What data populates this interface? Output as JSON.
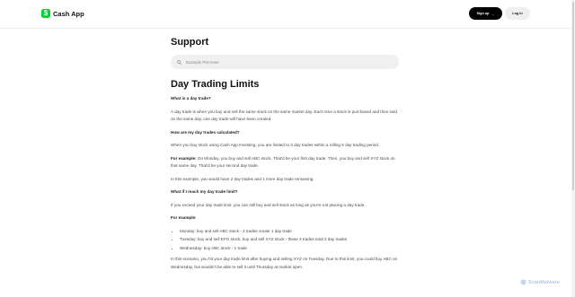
{
  "header": {
    "brand": "Cash App",
    "logo_glyph": "$",
    "signup_label": "Sign up",
    "signup_arrow": "→",
    "login_label": "Log in"
  },
  "support": {
    "title": "Support",
    "search_placeholder": "Example PIN reset"
  },
  "article": {
    "title": "Day Trading Limits",
    "q1": "What is a day trade?",
    "p1": "A day trade is when you buy and sell the same stock on the same market day. Each time a stock is purchased and then sold on the same day, one day trade will have been created.",
    "q2": "How are my day trades calculated?",
    "p2": "When you buy stock using Cash App Investing, you are limited to 3 day trades within a rolling 5 day trading period.",
    "p3_bold": "For example:",
    "p3": " On Monday, you buy and sell ABC stock. That'd be your first day trade. Then, you buy and sell XYZ stock on that same day. That'd be your second day trade.",
    "p4": "In this example, you would have 2 day trades and 1 more day trade remaining.",
    "q3": "What if I reach my day trade limit?",
    "p5": "If you exceed your day trade limit, you can still buy and sell stock as long as you're not placing a day trade.",
    "p6_bold": "For example:",
    "list": [
      "Monday: buy and sell ABC stock - 2 trades create 1 day trade",
      "Tuesday: buy and sell EFG stock, buy and sell XYZ stock - these 4 trades total 2 day trades",
      "Wednesday: buy ABC stock - 1 trade"
    ],
    "p7": "In this scenario, you hit your day trade limit after buying and selling XYZ on Tuesday. Due to this limit, you could buy ABC on Wednesday, but wouldn't be able to sell it until Thursday at market open."
  },
  "watermark": {
    "text": "ScanMalware"
  },
  "colors": {
    "brand_green": "#00d632",
    "signup_bg": "#000000",
    "login_bg": "#efefef"
  },
  "icons": {
    "logo": "dollar-logo-icon",
    "search": "search-icon",
    "arrow": "arrow-right-icon",
    "watermark": "shield-icon"
  }
}
